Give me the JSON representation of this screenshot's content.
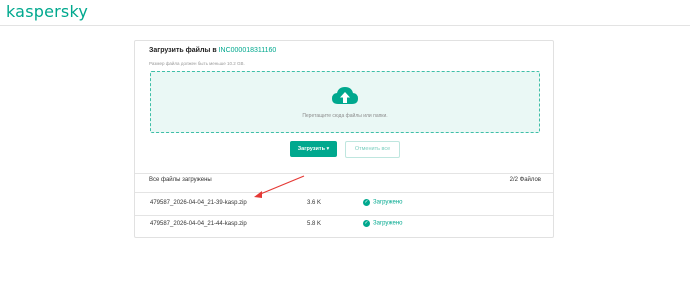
{
  "header": {
    "logo": "kaspersky"
  },
  "upload": {
    "title_prefix": "Загрузить файлы в",
    "incident_id": "INC000018311160",
    "size_hint": "Размер файла должен быть меньше 10.2 GB.",
    "drop_text": "Перетащите сюда файлы или папки.",
    "upload_button": "Загрузить ▾",
    "cancel_button": "Отменить все"
  },
  "files": {
    "summary": "Все файлы загружены",
    "count": "2/2 Файлов",
    "rows": [
      {
        "name": "479587_2026-04-04_21-39-kasp.zip",
        "size": "3.6 K",
        "status": "Загружено"
      },
      {
        "name": "479587_2026-04-04_21-44-kasp.zip",
        "size": "5.8 K",
        "status": "Загружено"
      }
    ]
  },
  "colors": {
    "accent": "#00a88e",
    "annotation_arrow": "#e53935"
  },
  "icons": {
    "cloud": "cloud-upload-icon",
    "check": "check-circle-icon"
  }
}
